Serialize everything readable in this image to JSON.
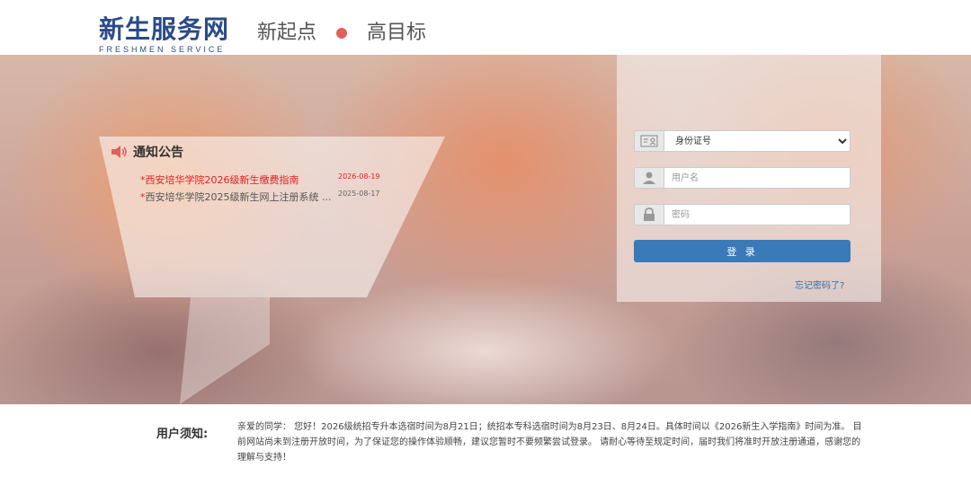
{
  "header": {
    "logo_text": "新生服务网",
    "logo_sub": "FRESHMEN SERVICE",
    "slogan_left": "新起点",
    "slogan_right": "高目标"
  },
  "notice": {
    "title": "通知公告",
    "icon": "speaker-icon",
    "items": [
      {
        "title": "西安培华学院2026级新生缴费指南",
        "date": "2026-08-19"
      },
      {
        "title": "西安培华学院2025级新生网上注册系统 ...",
        "date": "2025-08-17"
      }
    ]
  },
  "login": {
    "id_type_selected": "身份证号",
    "username_placeholder": "用户名",
    "password_placeholder": "密码",
    "login_label": "登 录",
    "forgot_label": "忘记密码了?"
  },
  "footer": {
    "label": "用户须知:",
    "text": "亲爱的同学： 您好！2026级统招专升本选宿时间为8月21日；统招本专科选宿时间为8月23日、8月24日。具体时间以《2026新生入学指南》时间为准。 目前网站尚未到注册开放时间，为了保证您的操作体验顺畅，建议您暂时不要频繁尝试登录。 请耐心等待至规定时间，届时我们将准时开放注册通道，感谢您的理解与支持！"
  },
  "colors": {
    "brand": "#2a4a8a",
    "slogan_dot": "#e0605a",
    "button": "#3b7ab8",
    "notice_highlight": "#dd2222"
  }
}
